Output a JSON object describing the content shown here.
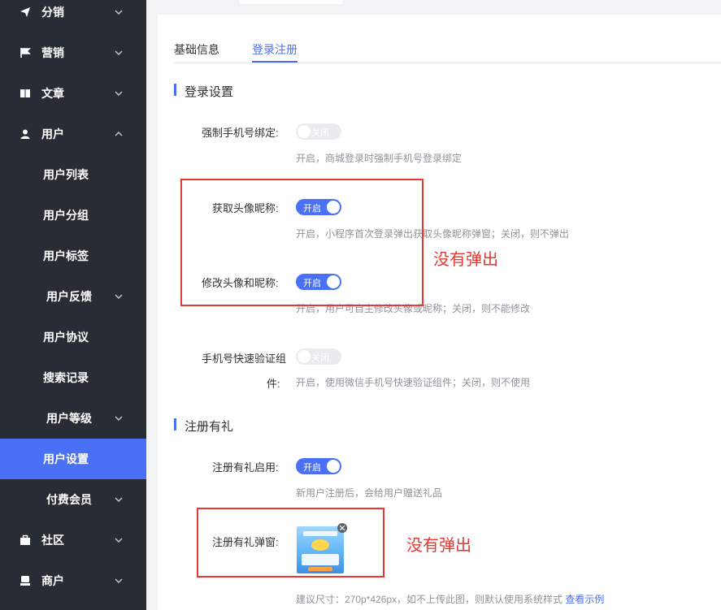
{
  "sidebar": {
    "items": [
      {
        "label": "分销",
        "icon": "send-icon"
      },
      {
        "label": "营销",
        "icon": "flag-icon"
      },
      {
        "label": "文章",
        "icon": "book-icon"
      },
      {
        "label": "用户",
        "icon": "user-icon"
      },
      {
        "label": "用户列表"
      },
      {
        "label": "用户分组"
      },
      {
        "label": "用户标签"
      },
      {
        "label": "用户反馈"
      },
      {
        "label": "用户协议"
      },
      {
        "label": "搜索记录"
      },
      {
        "label": "用户等级"
      },
      {
        "label": "用户设置"
      },
      {
        "label": "付费会员"
      },
      {
        "label": "社区",
        "icon": "briefcase-icon"
      },
      {
        "label": "商户",
        "icon": "shop-icon"
      }
    ],
    "active_color": "#4a71f5",
    "bg_color": "#282c34"
  },
  "tabs": [
    {
      "label": "基础信息"
    },
    {
      "label": "登录注册"
    }
  ],
  "login_section": {
    "title": "登录设置",
    "rows": [
      {
        "label": "强制手机号绑定:",
        "state": "关闭",
        "hint": "开启，商城登录时强制手机号登录绑定"
      },
      {
        "label": "获取头像昵称:",
        "state": "开启",
        "hint": "开启，小程序首次登录弹出获取头像昵称弹窗；关闭，则不弹出"
      },
      {
        "label": "修改头像和昵称:",
        "state": "开启",
        "hint": "开启，用户可自主修改头像或昵称；关闭，则不能修改"
      },
      {
        "label_line1": "手机号快速验证组",
        "label_line2": "件:",
        "state": "关闭",
        "hint": "开启，使用微信手机号快速验证组件；关闭，则不使用"
      }
    ]
  },
  "register_section": {
    "title": "注册有礼",
    "enable": {
      "label": "注册有礼启用:",
      "state": "开启",
      "hint": "新用户注册后，会给用户赠送礼品"
    },
    "popup": {
      "label": "注册有礼弹窗:",
      "hint": "建议尺寸：270p*426px，如不上传此图，则默认使用系统样式",
      "link": "查看示例"
    }
  },
  "annotations": [
    {
      "text": "没有弹出"
    },
    {
      "text": "没有弹出"
    }
  ],
  "colors": {
    "accent": "#4a71f5",
    "annotation": "#e53935"
  }
}
